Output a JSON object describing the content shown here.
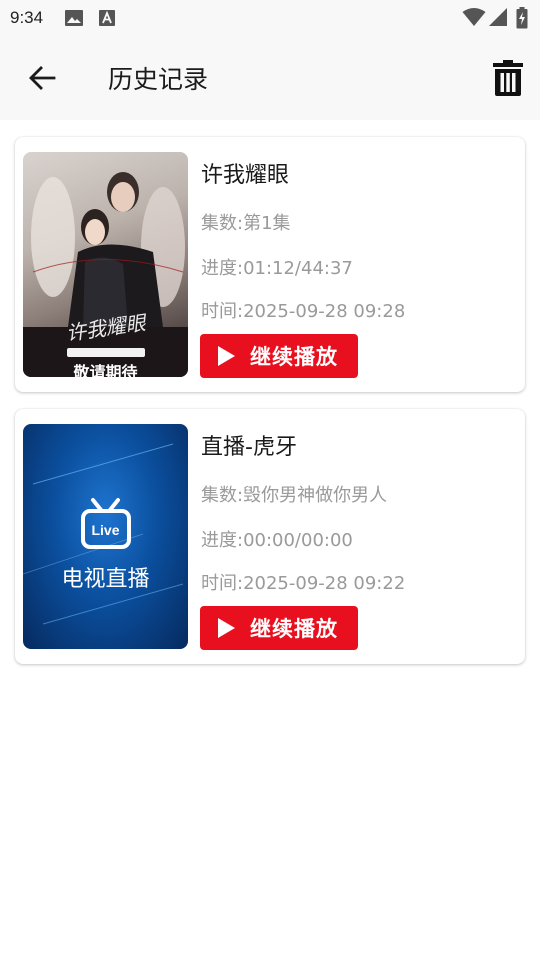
{
  "status_bar": {
    "time": "9:34",
    "icons": [
      "image-icon",
      "font-download-icon",
      "wifi-icon",
      "signal-icon",
      "battery-charging-icon"
    ]
  },
  "header": {
    "back_icon": "arrow-left-icon",
    "title": "历史记录",
    "delete_icon": "trash-icon"
  },
  "history": [
    {
      "title": "许我耀眼",
      "episodes": "集数:第1集",
      "progress": "进度:01:12/44:37",
      "time": "时间:2025-09-28 09:28",
      "button_label": "继续播放",
      "poster_calligraphy": "许我耀眼",
      "poster_caption": "敬请期待",
      "progress_fraction": 0.027
    },
    {
      "title": "直播-虎牙",
      "episodes": "集数:毁你男神做你男人",
      "progress": "进度:00:00/00:00",
      "time": "时间:2025-09-28 09:22",
      "button_label": "继续播放",
      "poster_badge": "Live",
      "poster_caption": "电视直播"
    }
  ],
  "colors": {
    "accent_red": "#e8101f",
    "meta_gray": "#9a9a9a",
    "bar_bg": "#f8f8f8",
    "live_blue": "#0b4f9e"
  }
}
